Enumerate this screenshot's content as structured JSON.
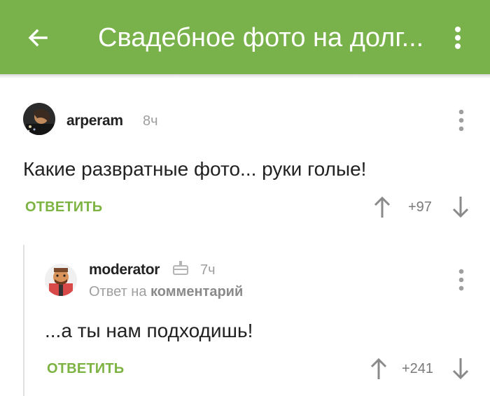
{
  "appbar": {
    "title": "Свадебное фото на долг...",
    "back_icon": "arrow-back-icon",
    "menu_icon": "more-vert-icon",
    "color": "#79b24a"
  },
  "comments": [
    {
      "author": "arperam",
      "time": "8ч",
      "text": "Какие развратные фото... руки голые!",
      "reply_label": "ОТВЕТИТЬ",
      "rating": "+97"
    },
    {
      "author": "moderator",
      "time": "7ч",
      "badge_icon": "moderator-cake-icon",
      "reply_to_prefix": "Ответ на",
      "reply_to_link": "комментарий",
      "text": "...а ты нам подходишь!",
      "reply_label": "ОТВЕТИТЬ",
      "rating": "+241"
    }
  ],
  "colors": {
    "accent": "#7cb342",
    "muted": "#9e9e9e"
  }
}
